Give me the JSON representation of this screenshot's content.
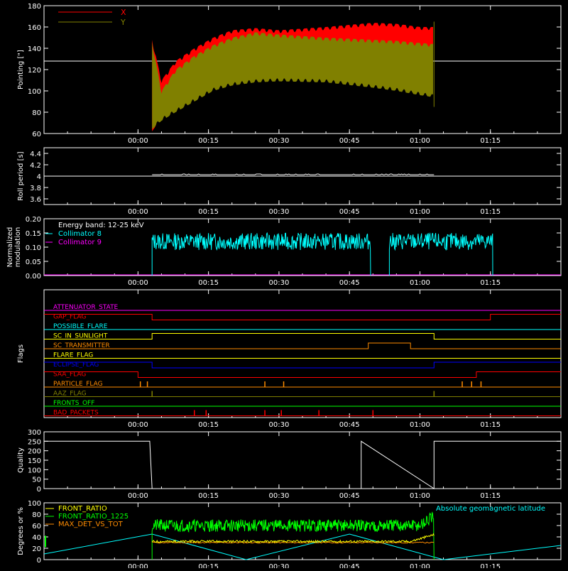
{
  "colors": {
    "background": "#000000",
    "axes": "#ffffff",
    "red": "#ff0000",
    "olive": "#808000",
    "cyan": "#00ffff",
    "magenta": "#ff00ff",
    "yellow": "#ffff00",
    "green": "#00ff00",
    "orange": "#ff8c00",
    "blue": "#0000ff"
  },
  "time_ticks": [
    "00:00",
    "00:15",
    "00:30",
    "00:45",
    "01:00",
    "01:15"
  ],
  "chart_data": [
    {
      "type": "line",
      "id": "pointing",
      "ylabel": "Pointing [\"]",
      "ylim": [
        60,
        180
      ],
      "yticks": [
        60,
        80,
        100,
        120,
        140,
        160,
        180
      ],
      "xlim_minutes": [
        -20,
        90
      ],
      "legend": [
        {
          "name": "X",
          "color": "#ff0000"
        },
        {
          "name": "Y",
          "color": "#808000"
        }
      ],
      "reference_line": 128,
      "series": [
        {
          "name": "X",
          "x": [
            3,
            5,
            8,
            12,
            16,
            20,
            25,
            30,
            40,
            50,
            55,
            60,
            63
          ],
          "upper": [
            148,
            110,
            128,
            140,
            150,
            157,
            159,
            157,
            160,
            164,
            163,
            160,
            160
          ],
          "lower": [
            62,
            75,
            88,
            100,
            110,
            115,
            117,
            118,
            120,
            130,
            135,
            138,
            138
          ]
        },
        {
          "name": "Y",
          "x": [
            3,
            5,
            8,
            12,
            16,
            20,
            25,
            30,
            40,
            50,
            55,
            60,
            63
          ],
          "upper": [
            146,
            100,
            120,
            133,
            143,
            150,
            155,
            153,
            150,
            148,
            147,
            145,
            144
          ],
          "lower": [
            64,
            72,
            80,
            90,
            100,
            105,
            108,
            109,
            108,
            103,
            100,
            96,
            94
          ]
        }
      ]
    },
    {
      "type": "line",
      "id": "roll",
      "ylabel": "Roll period [s]",
      "ylim": [
        3.5,
        4.5
      ],
      "yticks": [
        3.6,
        3.8,
        4.0,
        4.2,
        4.4
      ],
      "xlim_minutes": [
        -20,
        90
      ],
      "series": [
        {
          "name": "",
          "value": 4.0
        }
      ]
    },
    {
      "type": "line",
      "id": "modulation",
      "ylabel": "Normalized modulation",
      "ylim": [
        0,
        0.2
      ],
      "yticks": [
        0.0,
        0.05,
        0.1,
        0.15,
        0.2
      ],
      "ytick_labels": [
        "0.00",
        "0.05",
        "0.10",
        "0.15",
        "0.20"
      ],
      "xlim_minutes": [
        -20,
        90
      ],
      "annotation": "Energy band: 12-25 keV",
      "legend": [
        {
          "name": "Collimator 8",
          "color": "#00ffff"
        },
        {
          "name": "Collimator 9",
          "color": "#ff00ff"
        }
      ],
      "segments": [
        [
          3,
          49.5
        ],
        [
          53.5,
          75.5
        ]
      ],
      "mean": 0.12
    },
    {
      "type": "line",
      "id": "flags",
      "ylabel": "Flags",
      "xlim_minutes": [
        -20,
        90
      ],
      "flags": [
        {
          "name": "ATTENUATOR_STATE",
          "color": "#ff00ff",
          "steps": [
            [
              -20,
              0
            ]
          ]
        },
        {
          "name": "GAP_FLAG",
          "color": "#ff0000",
          "steps": [
            [
              -20,
              1
            ],
            [
              3,
              0
            ],
            [
              75,
              1
            ]
          ]
        },
        {
          "name": "POSSIBLE_FLARE",
          "color": "#00ffff",
          "steps": [
            [
              -20,
              0
            ]
          ]
        },
        {
          "name": "SC_IN_SUNLIGHT",
          "color": "#ffff00",
          "steps": [
            [
              -20,
              0
            ],
            [
              3,
              1
            ],
            [
              63,
              0
            ]
          ]
        },
        {
          "name": "SC_TRANSMITTER",
          "color": "#ff8c00",
          "steps": [
            [
              -20,
              0
            ],
            [
              49,
              1
            ],
            [
              58,
              0
            ]
          ]
        },
        {
          "name": "FLARE_FLAG",
          "color": "#ffff00",
          "steps": [
            [
              -20,
              0
            ]
          ]
        },
        {
          "name": "ECLIPSE_FLAG",
          "color": "#0000ff",
          "steps": [
            [
              -20,
              1
            ],
            [
              3,
              0
            ],
            [
              63,
              1
            ]
          ]
        },
        {
          "name": "SAA_FLAG",
          "color": "#ff0000",
          "steps": [
            [
              -20,
              1
            ],
            [
              0,
              0
            ],
            [
              72,
              1
            ]
          ]
        },
        {
          "name": "PARTICLE_FLAG",
          "color": "#ff8c00",
          "spikes": [
            0.5,
            2,
            27,
            31,
            69,
            71,
            73
          ]
        },
        {
          "name": "AAZ_FLAG",
          "color": "#808000",
          "spikes": [
            3,
            63
          ]
        },
        {
          "name": "FRONTS_OFF",
          "color": "#00ff00",
          "steps": [
            [
              -20,
              0
            ]
          ]
        },
        {
          "name": "BAD_PACKETS",
          "color": "#ff0000",
          "spikes": [
            12,
            14.5,
            27,
            30.5,
            38.5,
            50
          ]
        }
      ]
    },
    {
      "type": "line",
      "id": "quality",
      "ylabel": "Quality",
      "ylim": [
        0,
        300
      ],
      "yticks": [
        0,
        50,
        100,
        150,
        200,
        250,
        300
      ],
      "xlim_minutes": [
        -20,
        90
      ],
      "series": [
        {
          "name": "",
          "x": [
            -20,
            2.5,
            3,
            47.5,
            47.5,
            63,
            63,
            90
          ],
          "y": [
            250,
            250,
            0,
            0,
            250,
            0,
            250,
            250
          ]
        }
      ]
    },
    {
      "type": "line",
      "id": "ratios",
      "ylabel": "Degrees or %",
      "ylim": [
        0,
        100
      ],
      "yticks": [
        0,
        20,
        40,
        60,
        80,
        100
      ],
      "xlim_minutes": [
        -20,
        90
      ],
      "legend": [
        {
          "name": "FRONT_RATIO",
          "color": "#ffff00"
        },
        {
          "name": "FRONT_RATIO_1225",
          "color": "#00ff00"
        },
        {
          "name": "MAX_DET_VS_TOT",
          "color": "#ff8c00"
        }
      ],
      "right_legend": {
        "name": "Absolute geomagnetic latitude",
        "color": "#00ffff"
      },
      "series": [
        {
          "name": "FRONT_RATIO_1225",
          "range": [
            3,
            63
          ],
          "mean": 60
        },
        {
          "name": "FRONT_RATIO",
          "range": [
            3,
            63
          ],
          "mean": 32
        },
        {
          "name": "MAX_DET_VS_TOT",
          "range": [
            3,
            63
          ],
          "mean": 30
        },
        {
          "name": "Absolute geomagnetic latitude",
          "x": [
            -20,
            3,
            23,
            45,
            65,
            70,
            90
          ],
          "y": [
            10,
            45,
            0,
            45,
            0,
            5,
            25
          ]
        }
      ]
    }
  ]
}
